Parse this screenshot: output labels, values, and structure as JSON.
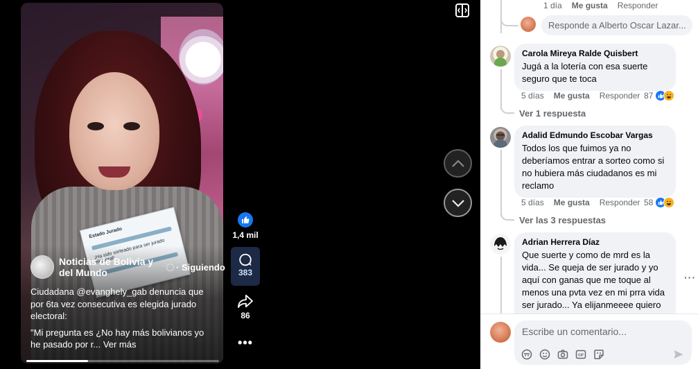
{
  "video": {
    "page_name": "Noticias de Bolivia y del Mundo",
    "follow_label": "Siguiendo",
    "caption": [
      "Ciudadana @evanghely_gab denuncia que por 6ta vez consecutiva es elegida jurado electoral:",
      "\"Mi pregunta es ¿No hay más bolivianos yo he pasado por r..."
    ],
    "see_more": "Ver más",
    "progress": 0.32,
    "sign_text_1": "Estado Jurado",
    "sign_text_2": "¡Ha sido sorteado para ser jurado electoral!"
  },
  "actions": {
    "like_count": "1,4 mil",
    "comment_count": "383",
    "share_count": "86",
    "more_label": "•••"
  },
  "top_meta": {
    "time": "1 día",
    "like": "Me gusta",
    "reply": "Responder"
  },
  "reply_box": {
    "placeholder": "Responde a Alberto Oscar Lazar..."
  },
  "comments": [
    {
      "author": "Carola Mireya Ralde Quisbert",
      "text": "Jugá a la lotería con esa suerte seguro que te toca",
      "time": "5 días",
      "like": "Me gusta",
      "reply": "Responder",
      "reactions": "87",
      "replies": "Ver 1 respuesta"
    },
    {
      "author": "Adalid Edmundo Escobar Vargas",
      "text": "Todos los que fuimos ya no deberíamos entrar a sorteo como si no hubiera más ciudadanos es mi reclamo",
      "time": "5 días",
      "like": "Me gusta",
      "reply": "Responder",
      "reactions": "58",
      "replies": "Ver las 3 respuestas"
    },
    {
      "author": "Adrian Herrera Díaz",
      "text": "Que suerte y como de mrd es la vida... Se queja de ser jurado y yo aquí con ganas que me toque al menos una pvta vez en mi prra vida ser jurado... Ya elijanmeeee quiero"
    }
  ],
  "composer": {
    "placeholder": "Escribe un comentario..."
  },
  "colors": {
    "accent": "#1877f2",
    "haha": "#f7b125",
    "bubble": "#f0f2f5",
    "meta": "#65676b"
  }
}
